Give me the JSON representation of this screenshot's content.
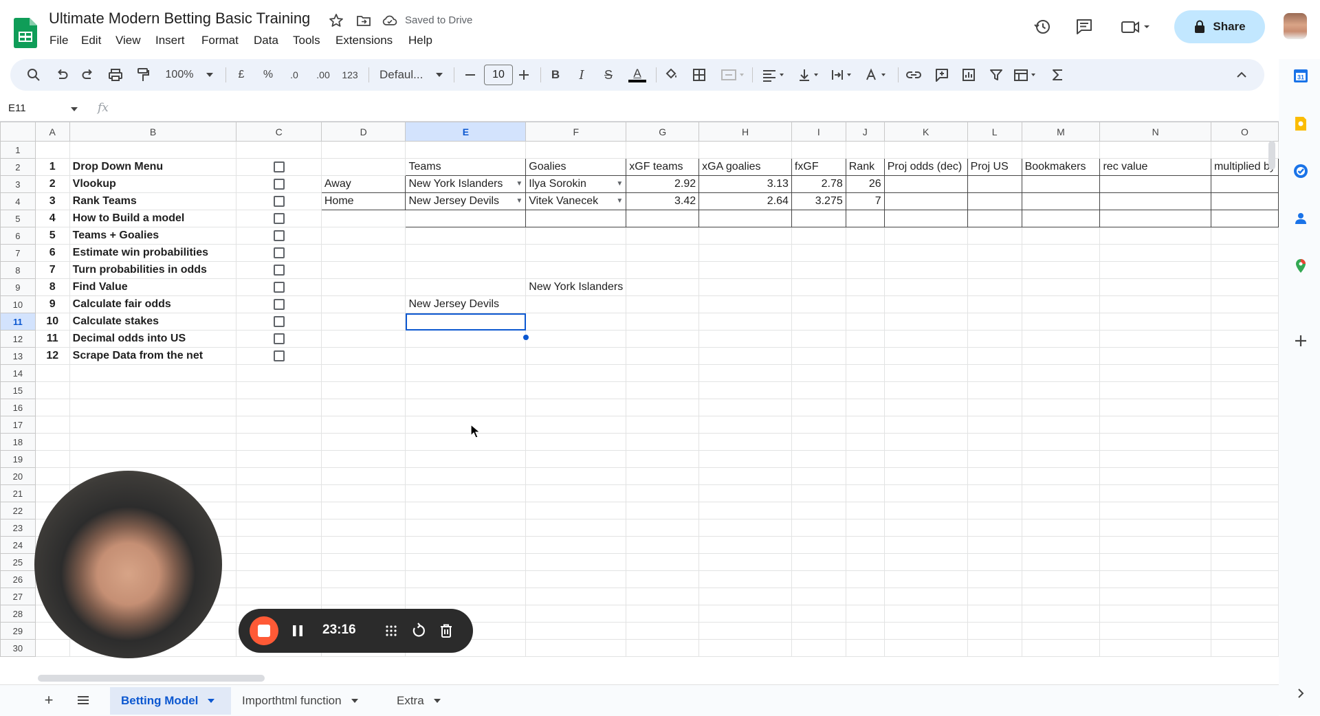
{
  "app": {
    "doc_title": "Ultimate Modern Betting Basic Training",
    "saved_status": "Saved to Drive",
    "share_label": "Share",
    "menu": [
      "File",
      "Edit",
      "View",
      "Insert",
      "Format",
      "Data",
      "Tools",
      "Extensions",
      "Help"
    ]
  },
  "toolbar": {
    "zoom": "100%",
    "currency": "£",
    "percent": "%",
    "dec_decrease": ".0",
    "dec_increase": ".00",
    "number_format": "123",
    "font": "Defaul...",
    "font_size": "10",
    "bold": "B",
    "italic": "I",
    "strike": "S",
    "text_color": "A"
  },
  "formula_bar": {
    "name_box": "E11",
    "fx": "fx",
    "formula": ""
  },
  "columns": [
    "A",
    "B",
    "C",
    "D",
    "E",
    "F",
    "G",
    "H",
    "I",
    "J",
    "K",
    "L",
    "M",
    "N",
    "O"
  ],
  "rows": [
    "1",
    "2",
    "3",
    "4",
    "5",
    "6",
    "7",
    "8",
    "9",
    "10",
    "11",
    "12",
    "13",
    "14",
    "15",
    "16",
    "17",
    "18",
    "19",
    "20",
    "21",
    "22",
    "23",
    "24",
    "25",
    "26",
    "27",
    "28",
    "29",
    "30"
  ],
  "lessons": [
    {
      "n": "1",
      "title": "Drop Down Menu"
    },
    {
      "n": "2",
      "title": "Vlookup"
    },
    {
      "n": "3",
      "title": "Rank Teams"
    },
    {
      "n": "4",
      "title": "How to Build a model"
    },
    {
      "n": "5",
      "title": "Teams + Goalies"
    },
    {
      "n": "6",
      "title": "Estimate win probabilities"
    },
    {
      "n": "7",
      "title": "Turn probabilities in odds"
    },
    {
      "n": "8",
      "title": "Find Value"
    },
    {
      "n": "9",
      "title": "Calculate fair odds"
    },
    {
      "n": "10",
      "title": "Calculate stakes"
    },
    {
      "n": "11",
      "title": "Decimal odds into US"
    },
    {
      "n": "12",
      "title": "Scrape Data from the net"
    }
  ],
  "model_table": {
    "headers": [
      "Teams",
      "Goalies",
      "xGF teams",
      "xGA goalies",
      "fxGF",
      "Rank",
      "Proj odds (dec)",
      "Proj US",
      "Bookmakers",
      "rec value",
      "multiplied by"
    ],
    "rows": [
      {
        "side": "Away",
        "team": "New York Islanders",
        "goalie": "Ilya Sorokin",
        "xgf": "2.92",
        "xga": "3.13",
        "fxgf": "2.78",
        "rank": "26"
      },
      {
        "side": "Home",
        "team": "New Jersey Devils",
        "goalie": "Vitek Vanecek",
        "xgf": "3.42",
        "xga": "2.64",
        "fxgf": "3.275",
        "rank": "7"
      }
    ]
  },
  "loose_cells": {
    "f9": "New York Islanders",
    "e10": "New Jersey Devils"
  },
  "sheets": {
    "tabs": [
      "Betting Model",
      "Importhtml function",
      "Extra"
    ],
    "active": "Betting Model"
  },
  "recorder": {
    "time": "23:16"
  },
  "colors": {
    "accent": "#0b57d0",
    "share_bg": "#c2e7ff",
    "sheets_green": "#0f9d58",
    "record_red": "#ff5a36"
  }
}
